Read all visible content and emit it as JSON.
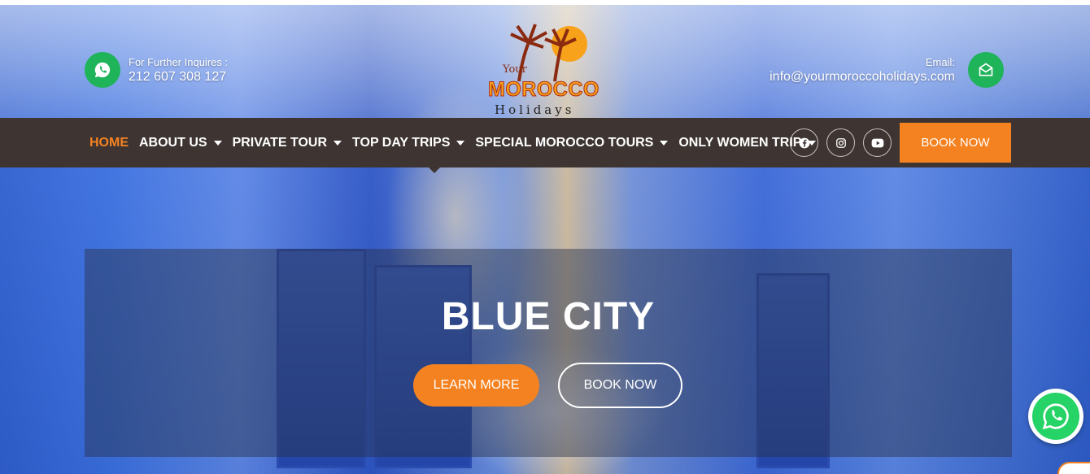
{
  "header": {
    "phone_label": "For Further Inquires :",
    "phone_value": "212 607 308 127",
    "email_label": "Email:",
    "email_value": "info@yourmoroccoholidays.com"
  },
  "logo": {
    "top_word": "Your",
    "main_word": "MOROCCO",
    "sub_word": "Holidays"
  },
  "nav": {
    "items": [
      {
        "label": "HOME",
        "active": true,
        "dropdown": false
      },
      {
        "label": "ABOUT US",
        "active": false,
        "dropdown": true
      },
      {
        "label": "PRIVATE TOUR",
        "active": false,
        "dropdown": true
      },
      {
        "label": "TOP DAY TRIPS",
        "active": false,
        "dropdown": true
      },
      {
        "label": "SPECIAL MOROCCO TOURS",
        "active": false,
        "dropdown": true
      },
      {
        "label": "ONLY WOMEN TRIP",
        "active": false,
        "dropdown": true
      }
    ],
    "socials": [
      "facebook-icon",
      "instagram-icon",
      "youtube-icon"
    ],
    "book_now": "BOOK NOW"
  },
  "hero": {
    "title": "BLUE CITY",
    "learn_more": "LEARN MORE",
    "book_now": "BOOK NOW"
  },
  "colors": {
    "accent": "#f58220",
    "nav_bg": "#3e3532",
    "whatsapp": "#1fb35a"
  }
}
